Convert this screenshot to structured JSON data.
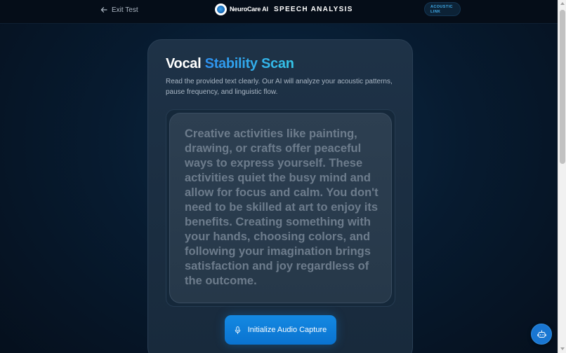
{
  "header": {
    "exit_label": "Exit Test",
    "brand_name": "NeuroCare AI",
    "page_label": "SPEECH ANALYSIS",
    "status_line1": "ACOUSTIC",
    "status_line2": "LINK"
  },
  "main": {
    "title_plain": "Vocal",
    "title_accent": "Stability Scan",
    "subtitle": "Read the provided text clearly. Our AI will analyze your acoustic patterns, pause frequency, and linguistic flow.",
    "passage": "Creative activities like painting, drawing, or crafts offer peaceful ways to express yourself. These activities quiet the busy mind and allow for focus and calm. You don't need to be skilled at art to enjoy its benefits. Creating something with your hands, choosing colors, and following your imagination brings satisfaction and joy regardless of the outcome.",
    "capture_button": "Initialize Audio Capture"
  },
  "icons": {
    "exit": "arrow-left-icon",
    "brand": "neurocare-logo-icon",
    "capture": "microphone-icon",
    "assistant": "robot-icon"
  },
  "colors": {
    "accent_start": "#2e90f0",
    "accent_end": "#35c6e8",
    "button": "#1489e2",
    "status_text": "#3fa9e6"
  }
}
